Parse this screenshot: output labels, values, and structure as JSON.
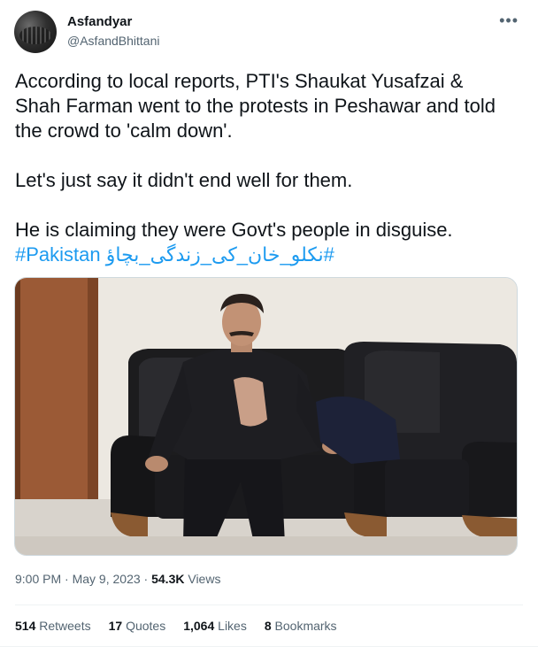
{
  "author": {
    "name": "Asfandyar",
    "handle": "@AsfandBhittani"
  },
  "more_icon": "•••",
  "tweet": {
    "line1": "According to local reports, PTI's Shaukat Yusafzai &",
    "line2": "Shah Farman went to the protests in Peshawar and told",
    "line3": "the crowd to 'calm down'.",
    "line4": "Let's just say it didn't end well for them.",
    "line5": "He is claiming they were Govt's people in disguise.",
    "hashtag1": "#Pakistan",
    "hashtag2": "#نکلو_خان_کی_زندگی_بچاؤ"
  },
  "meta": {
    "time": "9:00 PM",
    "separator": "·",
    "date": "May 9, 2023",
    "views_count": "54.3K",
    "views_label": "Views"
  },
  "stats": {
    "retweets_count": "514",
    "retweets_label": "Retweets",
    "quotes_count": "17",
    "quotes_label": "Quotes",
    "likes_count": "1,064",
    "likes_label": "Likes",
    "bookmarks_count": "8",
    "bookmarks_label": "Bookmarks"
  }
}
